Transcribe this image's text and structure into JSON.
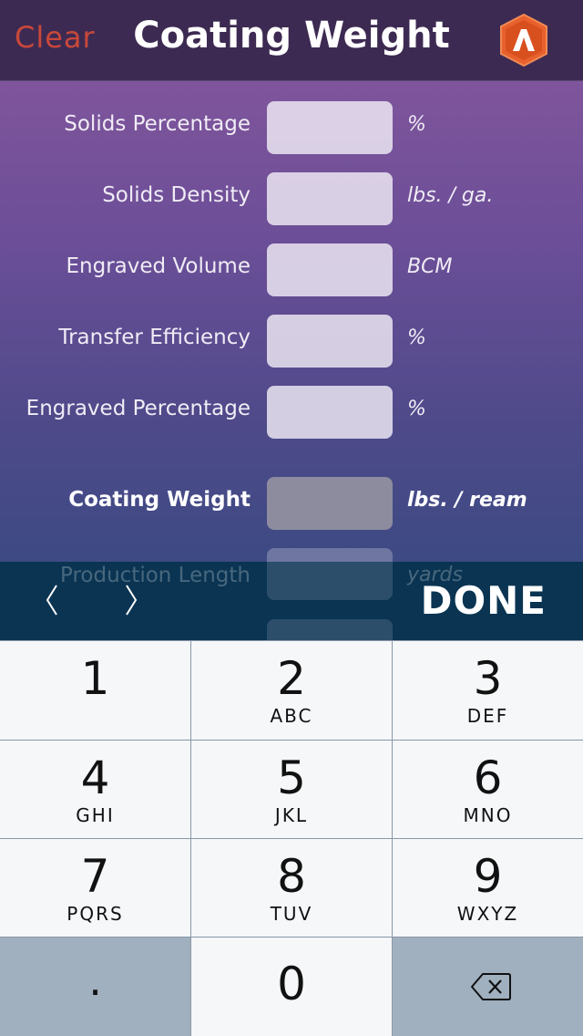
{
  "navbar": {
    "clear_label": "Clear",
    "title": "Coating Weight",
    "logo_icon": "app-logo-icon"
  },
  "form": {
    "rows": [
      {
        "label": "Solids Percentage",
        "unit": "%",
        "value": ""
      },
      {
        "label": "Solids Density",
        "unit": "lbs. / ga.",
        "value": ""
      },
      {
        "label": "Engraved Volume",
        "unit": "BCM",
        "value": ""
      },
      {
        "label": "Transfer Efficiency",
        "unit": "%",
        "value": ""
      },
      {
        "label": "Engraved Percentage",
        "unit": "%",
        "value": ""
      }
    ],
    "result": {
      "label": "Coating Weight",
      "unit": "lbs. / ream",
      "value": ""
    },
    "partial": {
      "label": "Production Length",
      "unit": "yards",
      "value": ""
    }
  },
  "toolbar": {
    "prev_icon": "chevron-left-icon",
    "next_icon": "chevron-right-icon",
    "done_label": "DONE"
  },
  "keypad": {
    "keys": [
      {
        "num": "1",
        "letters": ""
      },
      {
        "num": "2",
        "letters": "ABC"
      },
      {
        "num": "3",
        "letters": "DEF"
      },
      {
        "num": "4",
        "letters": "GHI"
      },
      {
        "num": "5",
        "letters": "JKL"
      },
      {
        "num": "6",
        "letters": "MNO"
      },
      {
        "num": "7",
        "letters": "PQRS"
      },
      {
        "num": "8",
        "letters": "TUV"
      },
      {
        "num": "9",
        "letters": "WXYZ"
      },
      {
        "num": ".",
        "letters": ""
      },
      {
        "num": "0",
        "letters": ""
      }
    ],
    "backspace_icon": "backspace-icon"
  },
  "colors": {
    "navbar_bg": "#3d2a52",
    "clear_accent": "#c8483a",
    "logo_orange": "#e8612c",
    "toolbar_bg": "#063450"
  }
}
